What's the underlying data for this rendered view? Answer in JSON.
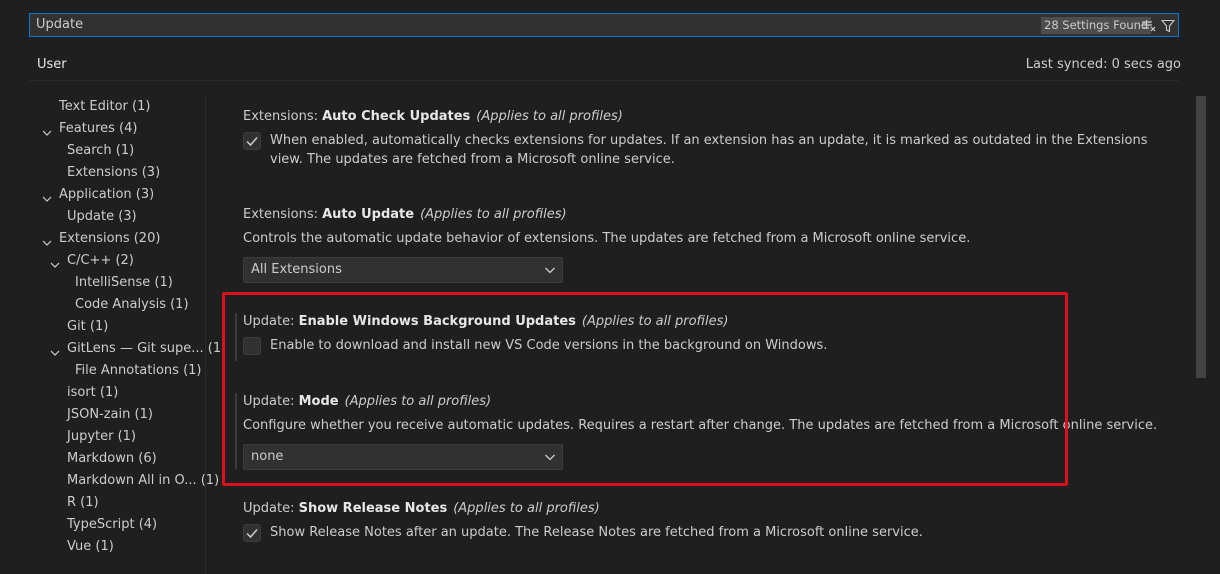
{
  "search": {
    "value": "Update",
    "results_count": "28 Settings Found",
    "clear_icon": "clear-filter-icon",
    "filter_icon": "filter-icon"
  },
  "tabs": [
    {
      "label": "User"
    }
  ],
  "last_synced": "Last synced: 0 secs ago",
  "toc": [
    {
      "label": "Text Editor (1)",
      "expandable": false
    },
    {
      "label": "Features (4)",
      "expandable": true
    },
    {
      "label": "Search (1)",
      "expandable": false
    },
    {
      "label": "Extensions (3)",
      "expandable": false
    },
    {
      "label": "Application (3)",
      "expandable": true
    },
    {
      "label": "Update (3)",
      "expandable": false
    },
    {
      "label": "Extensions (20)",
      "expandable": true
    },
    {
      "label": "C/C++ (2)",
      "expandable": true
    },
    {
      "label": "IntelliSense (1)",
      "expandable": false
    },
    {
      "label": "Code Analysis (1)",
      "expandable": false
    },
    {
      "label": "Git (1)",
      "expandable": false
    },
    {
      "label": "GitLens — Git supe... (1)",
      "expandable": true
    },
    {
      "label": "File Annotations (1)",
      "expandable": false
    },
    {
      "label": "isort (1)",
      "expandable": false
    },
    {
      "label": "JSON-zain (1)",
      "expandable": false
    },
    {
      "label": "Jupyter (1)",
      "expandable": false
    },
    {
      "label": "Markdown (6)",
      "expandable": false
    },
    {
      "label": "Markdown All in O... (1)",
      "expandable": false
    },
    {
      "label": "R (1)",
      "expandable": false
    },
    {
      "label": "TypeScript (4)",
      "expandable": false
    },
    {
      "label": "Vue (1)",
      "expandable": false
    }
  ],
  "settings": [
    {
      "category": "Extensions: ",
      "name": "Auto Check Updates",
      "scope": "(Applies to all profiles)",
      "type": "checkbox",
      "checked": true,
      "description": "When enabled, automatically checks extensions for updates. If an extension has an update, it is marked as outdated in the Extensions view. The updates are fetched from a Microsoft online service."
    },
    {
      "category": "Extensions: ",
      "name": "Auto Update",
      "scope": "(Applies to all profiles)",
      "type": "dropdown",
      "description": "Controls the automatic update behavior of extensions. The updates are fetched from a Microsoft online service.",
      "value": "All Extensions"
    },
    {
      "category": "Update: ",
      "name": "Enable Windows Background Updates",
      "scope": "(Applies to all profiles)",
      "type": "checkbox",
      "checked": false,
      "description": "Enable to download and install new VS Code versions in the background on Windows."
    },
    {
      "category": "Update: ",
      "name": "Mode",
      "scope": "(Applies to all profiles)",
      "type": "dropdown",
      "description": "Configure whether you receive automatic updates. Requires a restart after change. The updates are fetched from a Microsoft online service.",
      "value": "none"
    },
    {
      "category": "Update: ",
      "name": "Show Release Notes",
      "scope": "(Applies to all profiles)",
      "type": "checkbox",
      "checked": true,
      "description": "Show Release Notes after an update. The Release Notes are fetched from a Microsoft online service."
    }
  ],
  "colors": {
    "background": "#1f1f1f",
    "focus_border": "#0078d4",
    "highlight_annotation": "#d8111f"
  }
}
